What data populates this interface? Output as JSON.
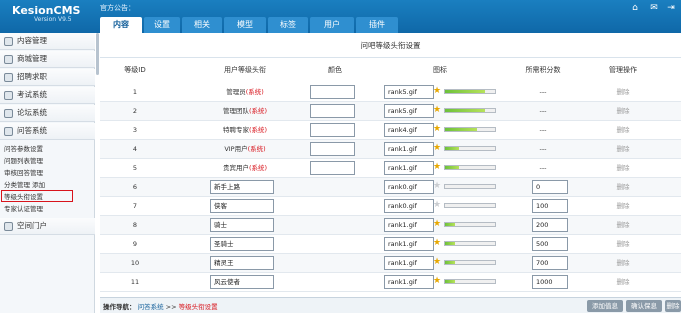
{
  "header": {
    "logo": "KesionCMS",
    "version": "Version V9.5",
    "notice_label": "官方公告：",
    "icons": [
      "home-icon",
      "mail-icon",
      "logout-icon"
    ]
  },
  "tabs": [
    {
      "label": "内容",
      "active": true
    },
    {
      "label": "设置",
      "active": false
    },
    {
      "label": "相关",
      "active": false
    },
    {
      "label": "模型",
      "active": false
    },
    {
      "label": "标签",
      "active": false
    },
    {
      "label": "用户",
      "active": false
    },
    {
      "label": "插件",
      "active": false
    }
  ],
  "sidebar": {
    "categories": [
      "内容管理",
      "商城管理",
      "招聘求职",
      "考试系统",
      "论坛系统",
      "问答系统",
      "空间门户"
    ],
    "sub_items": [
      "问答参数设置",
      "问题列表管理",
      "审核回答管理",
      "分类管理 添加",
      "等级头衔设置",
      "专家认证管理"
    ],
    "highlighted": "等级头衔设置"
  },
  "page_title": "问吧等级头衔设置",
  "table": {
    "headers": [
      "等级ID",
      "用户等级头衔",
      "颜色",
      "图标",
      "所需积分数",
      "管理操作"
    ],
    "rows": [
      {
        "id": "1",
        "title": "管理员",
        "sys": "(系统)",
        "icon": "rank5.gif",
        "score": "---",
        "op": "删除",
        "editable": false
      },
      {
        "id": "2",
        "title": "管理团队",
        "sys": "(系统)",
        "icon": "rank5.gif",
        "score": "---",
        "op": "删除",
        "editable": false
      },
      {
        "id": "3",
        "title": "特聘专家",
        "sys": "(系统)",
        "icon": "rank4.gif",
        "score": "---",
        "op": "删除",
        "editable": false
      },
      {
        "id": "4",
        "title": "VIP用户",
        "sys": "(系统)",
        "icon": "rank1.gif",
        "score": "---",
        "op": "删除",
        "editable": false
      },
      {
        "id": "5",
        "title": "贵宾用户",
        "sys": "(系统)",
        "icon": "rank1.gif",
        "score": "---",
        "op": "删除",
        "editable": false
      },
      {
        "id": "6",
        "title": "新手上路",
        "sys": "",
        "icon": "rank0.gif",
        "score": "0",
        "op": "删除",
        "editable": true
      },
      {
        "id": "7",
        "title": "侠客",
        "sys": "",
        "icon": "rank0.gif",
        "score": "100",
        "op": "删除",
        "editable": true
      },
      {
        "id": "8",
        "title": "骑士",
        "sys": "",
        "icon": "rank1.gif",
        "score": "200",
        "op": "删除",
        "editable": true
      },
      {
        "id": "9",
        "title": "圣骑士",
        "sys": "",
        "icon": "rank1.gif",
        "score": "500",
        "op": "删除",
        "editable": true
      },
      {
        "id": "10",
        "title": "精灵王",
        "sys": "",
        "icon": "rank1.gif",
        "score": "700",
        "op": "删除",
        "editable": true
      },
      {
        "id": "11",
        "title": "风云使者",
        "sys": "",
        "icon": "rank1.gif",
        "score": "1000",
        "op": "删除",
        "editable": true
      }
    ]
  },
  "footer": {
    "nav_label": "操作导航：",
    "crumb1": "问答系统",
    "sep": ">>",
    "crumb2": "等级头衔设置",
    "buttons": [
      "添加值息",
      "确认保息",
      "删除"
    ]
  },
  "colors": {
    "brand": "#1272b5",
    "system_tag": "#d8141c",
    "star": "#e8a800"
  }
}
